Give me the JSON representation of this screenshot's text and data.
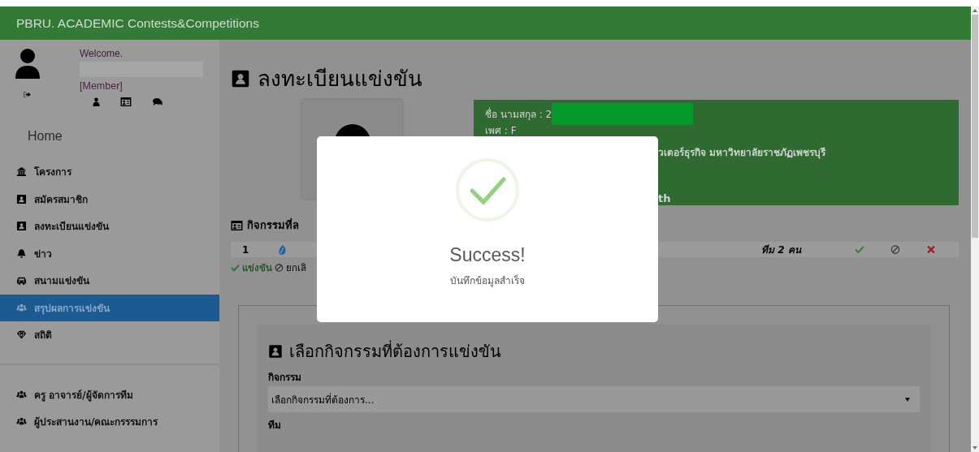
{
  "header": {
    "title": "PBRU. ACADEMIC Contests&Competitions"
  },
  "user": {
    "greeting": "Welcome.",
    "role": "[Member]"
  },
  "sidebar": {
    "home": "Home",
    "items": [
      {
        "kind": "bank",
        "label": "โครงการ",
        "selected": false
      },
      {
        "kind": "contact",
        "label": "สมัครสมาชิก",
        "selected": false
      },
      {
        "kind": "contact",
        "label": "ลงทะเบียนแข่งขัน",
        "selected": false
      },
      {
        "kind": "bell",
        "label": "ข่าว",
        "selected": false
      },
      {
        "kind": "car",
        "label": "สนามแข่งขัน",
        "selected": false
      },
      {
        "kind": "users",
        "label": "สรุปผลการแข่งขัน",
        "selected": true
      },
      {
        "kind": "diamond",
        "label": "สถิติ",
        "selected": false
      }
    ],
    "staff_links": [
      {
        "kind": "users",
        "label": "ครู อาจารย์/ผู้จัดการทีม"
      },
      {
        "kind": "users",
        "label": "ผู้ประสานงาน/คณะกรรรมการ"
      }
    ]
  },
  "page": {
    "title": "ลงทะเบียนแข่งขัน"
  },
  "profile": {
    "name_label": "ชื่อ นามสกุล : 2",
    "gender": "เพศ : F",
    "line_3": "วเตอร์ธุรกิจ มหาวิทยาลัยราชภัฏเพชรบุรี",
    "line_5": "th"
  },
  "activities": {
    "heading": "กิจกรรมที่ล",
    "rows": [
      {
        "number": "1",
        "team": "ทีม 2 คน"
      }
    ],
    "legend": [
      "แข่งขัน",
      "ยกเลิ"
    ]
  },
  "form": {
    "title": "เลือกกิจกรรมที่ต้องการแข่งขัน",
    "activity_label": "กิจกรรม",
    "activity_value": "เลือกกิจกรรมที่ต้องการ...",
    "team_label": "ทีม"
  },
  "dialog": {
    "title": "Success!",
    "message": "บันทึกข้อมูลสำเร็จ"
  }
}
